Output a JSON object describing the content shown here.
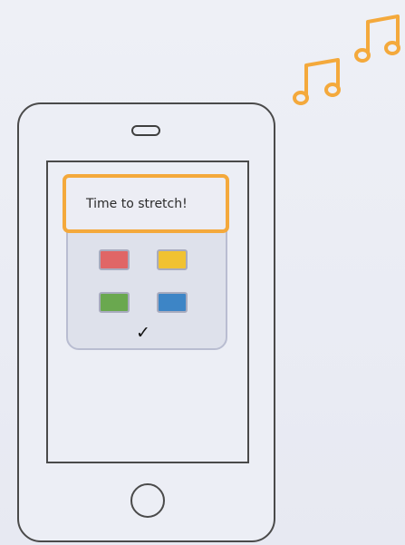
{
  "notification": {
    "text": "Time to stretch!"
  },
  "colors": {
    "accent": "#f4a93c",
    "swatch_red": "#e06666",
    "swatch_yellow": "#f1c232",
    "swatch_green": "#6aa84f",
    "swatch_blue": "#3d85c6"
  },
  "confirm": {
    "glyph": "✓"
  },
  "icons": [
    "music-notes-icon",
    "check-icon"
  ]
}
